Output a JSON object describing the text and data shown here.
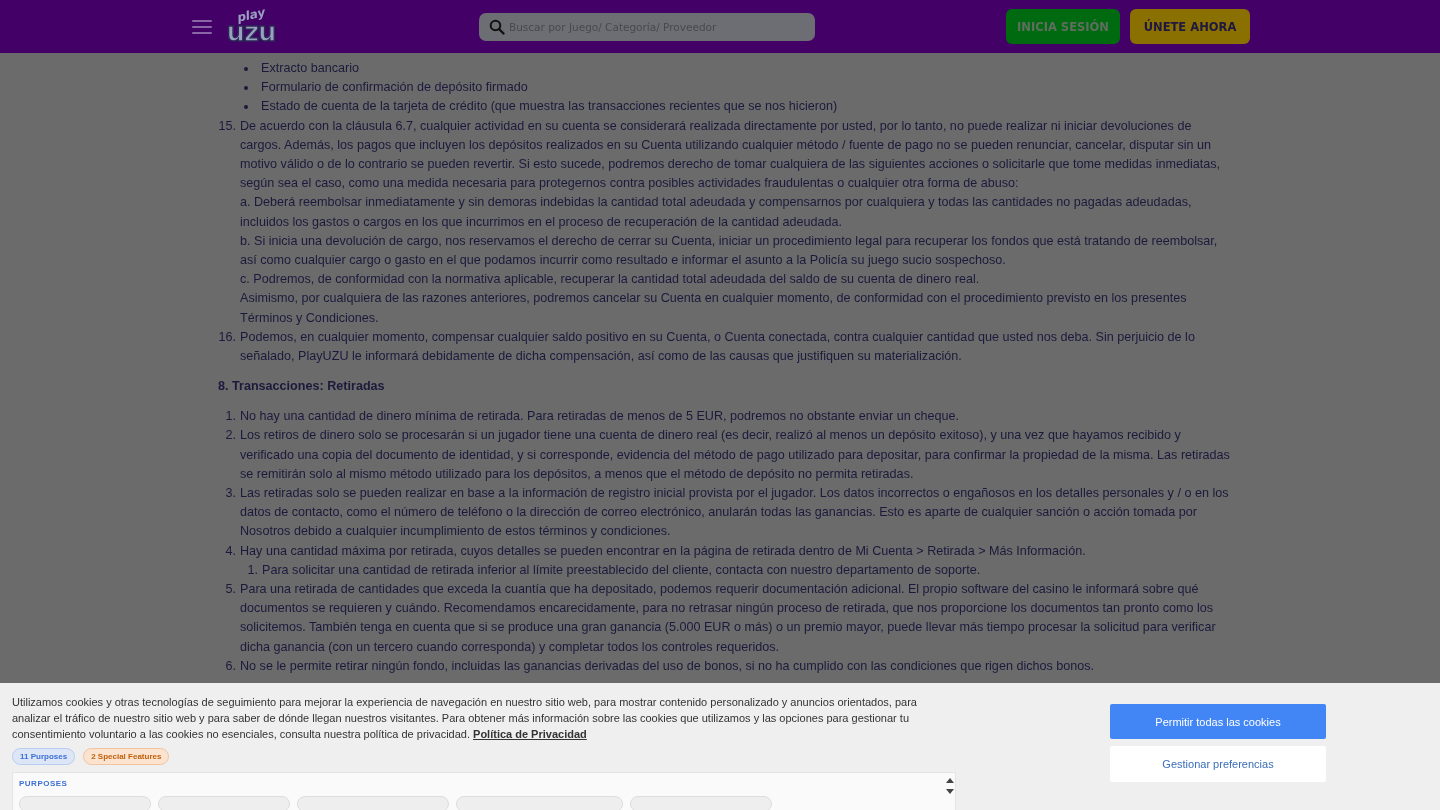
{
  "header": {
    "logo": {
      "top": "play",
      "bottom": "uzu"
    },
    "search": {
      "placeholder": "Buscar por Juego/ Categoría/ Proveedor"
    },
    "buttons": [
      {
        "label": "INICIA SESIÓN",
        "kind": "login"
      },
      {
        "label": "ÚNETE AHORA",
        "kind": "join"
      }
    ]
  },
  "bullets": [
    "Extracto bancario",
    "Formulario de confirmación de depósito firmado",
    "Estado de cuenta de la tarjeta de crédito (que muestra las transacciones recientes que se nos hicieron)"
  ],
  "items": [
    {
      "number": "15.",
      "paragraphs": [
        "De acuerdo con la cláusula 6.7, cualquier actividad en su cuenta se considerará realizada directamente por usted, por lo tanto, no puede realizar ni iniciar devoluciones de cargos. Además, los pagos que incluyen los depósitos realizados en su Cuenta utilizando cualquier método / fuente de pago no se pueden renunciar, cancelar, disputar sin un motivo válido o de lo contrario se pueden revertir. Si esto sucede, podremos derecho de tomar cualquiera de las siguientes acciones o solicitarle que tome medidas inmediatas, según sea el caso, como una medida necesaria para protegernos contra posibles actividades fraudulentas o cualquier otra forma de abuso:",
        "a. Deberá reembolsar inmediatamente y sin demoras indebidas la cantidad total adeudada y compensarnos por cualquiera y todas las cantidades no pagadas adeudadas, incluidos los gastos o cargos en los que incurrimos en el proceso de recuperación de la cantidad adeudada.",
        "b. Si inicia una devolución de cargo, nos reservamos el derecho de cerrar su Cuenta, iniciar un procedimiento legal para recuperar los fondos que está tratando de reembolsar, así como cualquier cargo o gasto en el que podamos incurrir como resultado e informar el asunto a la Policía su juego sucio sospechoso.",
        "c. Podremos, de conformidad con la normativa aplicable, recuperar la cantidad total adeudada del saldo de su cuenta de dinero real.",
        "Asimismo, por cualquiera de las razones anteriores, podremos cancelar su Cuenta en cualquier momento, de conformidad con el procedimiento previsto en los presentes Términos y Condiciones."
      ]
    },
    {
      "number": "16.",
      "paragraphs": [
        "Podemos, en cualquier momento, compensar cualquier saldo positivo en su Cuenta, o Cuenta conectada, contra cualquier cantidad que usted nos deba. Sin perjuicio de lo señalado, PlayUZU le informará debidamente de dicha compensación, así como de las causas que justifiquen su materialización."
      ]
    }
  ],
  "section": {
    "heading": "8. Transacciones: Retiradas",
    "items": [
      {
        "number": "1.",
        "paragraphs": [
          "No hay una cantidad de dinero mínima de retirada. Para retiradas de menos de 5 EUR, podremos no obstante enviar un cheque."
        ]
      },
      {
        "number": "2.",
        "paragraphs": [
          "Los retiros de dinero solo se procesarán si un jugador tiene una cuenta de dinero real (es decir, realizó al menos un depósito exitoso), y una vez que hayamos recibido y verificado una copia del documento de identidad, y si corresponde, evidencia del método de pago utilizado para depositar, para confirmar la propiedad de la misma. Las retiradas se remitirán solo al mismo método utilizado para los depósitos, a menos que el método de depósito no permita retiradas."
        ]
      },
      {
        "number": "3.",
        "paragraphs": [
          "Las retiradas solo se pueden realizar en base a la información de registro inicial provista por el jugador. Los datos incorrectos o engañosos en los detalles personales y / o en los datos de contacto, como el número de teléfono o la dirección de correo electrónico, anularán todas las ganancias. Esto es aparte de cualquier sanción o acción tomada por Nosotros debido a cualquier incumplimiento de estos términos y condiciones."
        ]
      },
      {
        "number": "4.",
        "paragraphs": [
          "Hay una cantidad máxima por retirada, cuyos detalles se pueden encontrar en la página de retirada dentro de Mi Cuenta > Retirada > Más Información."
        ],
        "children": [
          {
            "number": "1.",
            "paragraphs": [
              "Para solicitar una cantidad de retirada inferior al límite preestablecido del cliente, contacta con nuestro departamento de soporte."
            ]
          }
        ]
      },
      {
        "number": "5.",
        "paragraphs": [
          "Para una retirada de cantidades que exceda la cuantía que ha depositado, podemos requerir documentación adicional. El propio software del casino le informará sobre qué documentos se requieren y cuándo. Recomendamos encarecidamente, para no retrasar ningún proceso de retirada, que nos proporcione los documentos tan pronto como los solicitemos. También tenga en cuenta que si se produce una gran ganancia (5.000 EUR o más) o un premio mayor, puede llevar más tiempo procesar la solicitud para verificar dicha ganancia (con un tercero cuando corresponda) y completar todos los controles requeridos."
        ]
      },
      {
        "number": "6.",
        "paragraphs": [
          "No se le permite retirar ningún fondo, incluidas las ganancias derivadas del uso de bonos, si no ha cumplido con las condiciones que rigen dichos bonos."
        ]
      }
    ]
  },
  "cookie_banner": {
    "text": "Utilizamos cookies y otras tecnologías de seguimiento para mejorar la experiencia de navegación en nuestro sitio web, para mostrar contenido personalizado y anuncios orientados, para analizar el tráfico de nuestro sitio web y para saber de dónde llegan nuestros visitantes. Para obtener más información sobre las cookies que utilizamos y las opciones para gestionar tu consentimiento voluntario a las cookies no esenciales, consulta nuestra política de privacidad.",
    "link": "Política de Privacidad",
    "badges": [
      {
        "label": "11 Purposes",
        "kind": "purposes"
      },
      {
        "label": "2 Special Features",
        "kind": "features"
      }
    ],
    "purposes_title": "PURPOSES",
    "buttons": [
      {
        "label": "Permitir todas las cookies",
        "kind": "primary"
      },
      {
        "label": "Gestionar preferencias",
        "kind": "secondary"
      }
    ]
  }
}
